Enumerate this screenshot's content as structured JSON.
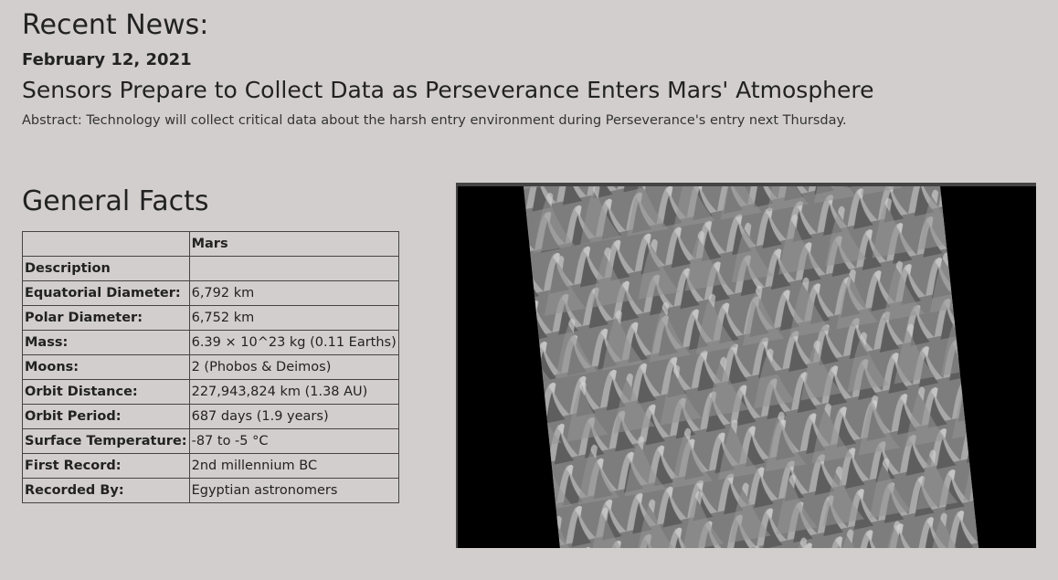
{
  "news": {
    "heading": "Recent News:",
    "date": "February 12, 2021",
    "title": "Sensors Prepare to Collect Data as Perseverance Enters Mars' Atmosphere",
    "abstract": "Abstract: Technology will collect critical data about the harsh entry environment during Perseverance's entry next Thursday."
  },
  "facts": {
    "heading": "General Facts",
    "column_header": "Mars",
    "rows": [
      {
        "label": "Description",
        "value": ""
      },
      {
        "label": "Equatorial Diameter:",
        "value": "6,792 km"
      },
      {
        "label": "Polar Diameter:",
        "value": "6,752 km"
      },
      {
        "label": "Mass:",
        "value": "6.39 × 10^23 kg (0.11 Earths)"
      },
      {
        "label": "Moons:",
        "value": "2 (Phobos & Deimos)"
      },
      {
        "label": "Orbit Distance:",
        "value": "227,943,824 km (1.38 AU)"
      },
      {
        "label": "Orbit Period:",
        "value": "687 days (1.9 years)"
      },
      {
        "label": "Surface Temperature:",
        "value": "-87 to -5 °C"
      },
      {
        "label": "First Record:",
        "value": "2nd millennium BC"
      },
      {
        "label": "Recorded By:",
        "value": "Egyptian astronomers"
      }
    ]
  },
  "image": {
    "subject": "mars-dunes-image"
  },
  "colors": {
    "background": "#d3cece",
    "text": "#222222",
    "image_background": "#000000"
  }
}
